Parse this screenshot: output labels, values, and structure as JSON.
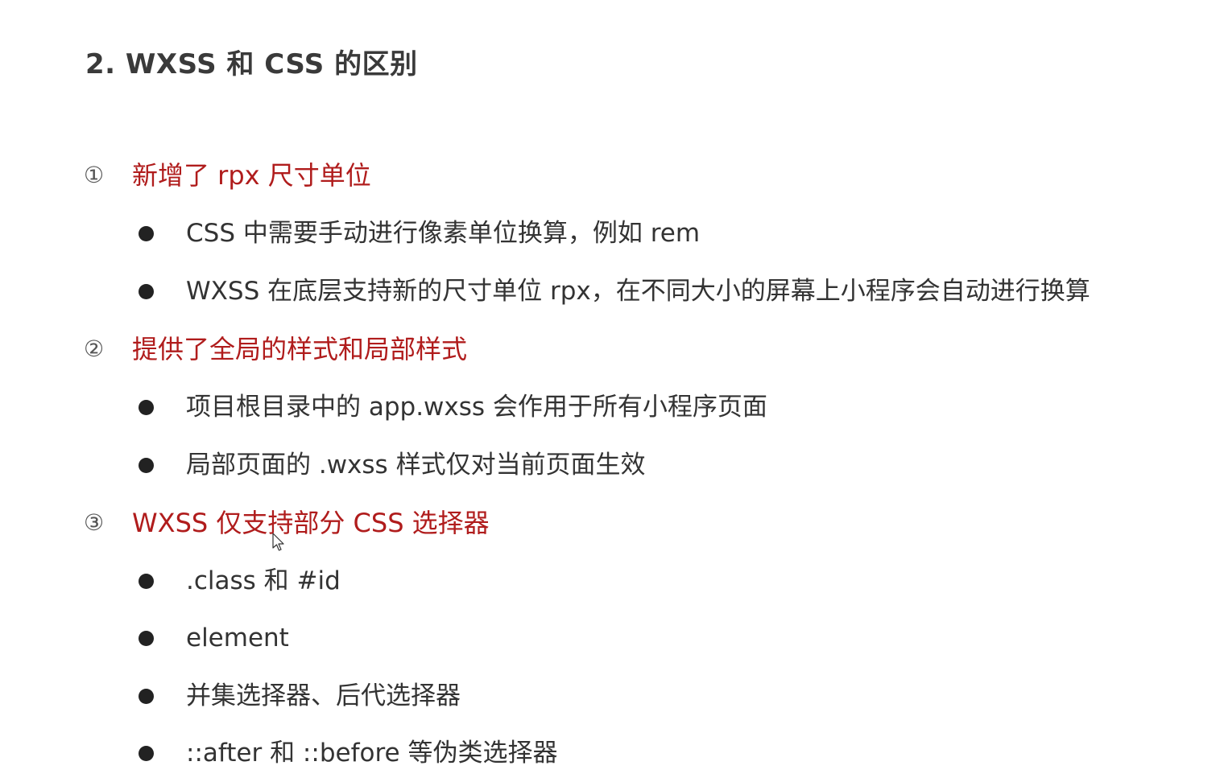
{
  "title": "2. WXSS 和 CSS 的区别",
  "sections": [
    {
      "number": "①",
      "heading": "新增了 rpx 尺寸单位",
      "bullets": [
        "CSS 中需要手动进行像素单位换算，例如 rem",
        "WXSS 在底层支持新的尺寸单位 rpx，在不同大小的屏幕上小程序会自动进行换算"
      ]
    },
    {
      "number": "②",
      "heading": "提供了全局的样式和局部样式",
      "bullets": [
        "项目根目录中的 app.wxss 会作用于所有小程序页面",
        "局部页面的 .wxss 样式仅对当前页面生效"
      ]
    },
    {
      "number": "③",
      "heading": "WXSS 仅支持部分 CSS 选择器",
      "bullets": [
        ".class 和 #id",
        "element",
        "并集选择器、后代选择器",
        "::after 和 ::before 等伪类选择器"
      ]
    }
  ],
  "colors": {
    "heading": "#b01c1c",
    "title": "#3a3a3a",
    "body_text": "#333333"
  }
}
